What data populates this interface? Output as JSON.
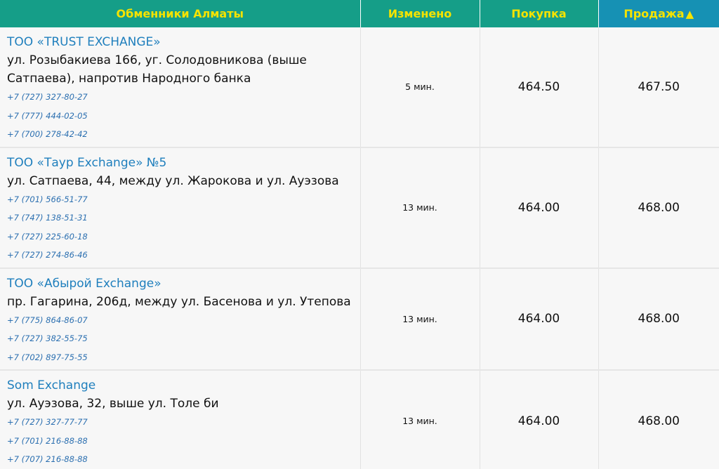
{
  "table": {
    "headers": {
      "name": "Обменники Алматы",
      "changed": "Изменено",
      "buy": "Покупка",
      "sell": "Продажа"
    },
    "sort": {
      "column": "sell",
      "direction": "ascending",
      "indicator": "▲"
    },
    "rows": [
      {
        "name": "ТОО «TRUST EXCHANGE»",
        "address": "ул. Розыбакиева 166, уг. Солодовникова (выше Сатпаева), напротив Народного банка",
        "phones": [
          "+7 (727) 327-80-27",
          "+7 (777) 444-02-05",
          "+7 (700) 278-42-42"
        ],
        "changed": "5 мин.",
        "buy": "464.50",
        "sell": "467.50"
      },
      {
        "name": "ТОО «Таур Exchange» №5",
        "address": "ул. Сатпаева, 44, между ул. Жарокова и ул. Ауэзова",
        "phones": [
          "+7 (701) 566-51-77",
          "+7 (747) 138-51-31",
          "+7 (727) 225-60-18",
          "+7 (727) 274-86-46"
        ],
        "changed": "13 мин.",
        "buy": "464.00",
        "sell": "468.00"
      },
      {
        "name": "ТОО «Абырой Exchange»",
        "address": "пр. Гагарина, 206д, между ул. Басенова и ул. Утепова",
        "phones": [
          "+7 (775) 864-86-07",
          "+7 (727) 382-55-75",
          "+7 (702) 897-75-55"
        ],
        "changed": "13 мин.",
        "buy": "464.00",
        "sell": "468.00"
      },
      {
        "name": "Som Exchange",
        "address": "ул. Ауэзова, 32, выше ул. Толе би",
        "phones": [
          "+7 (727) 327-77-77",
          "+7 (701) 216-88-88",
          "+7 (707) 216-88-88"
        ],
        "changed": "13 мин.",
        "buy": "464.00",
        "sell": "468.00"
      }
    ]
  },
  "colors": {
    "header_bg": "#159e88",
    "header_sorted_bg": "#1691b4",
    "header_text": "#f5e300",
    "link": "#1f7fbd",
    "row_bg": "#f7f7f7"
  }
}
